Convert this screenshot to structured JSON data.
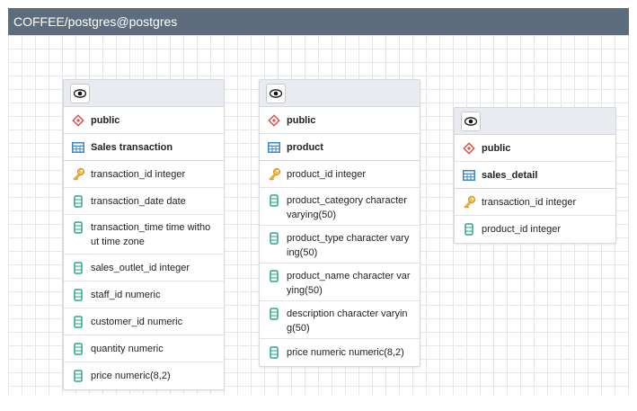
{
  "window": {
    "title": "COFFEE/postgres@postgres"
  },
  "colors": {
    "titlebar": "#5e6d7e",
    "schema_icon": "#d9534f",
    "table_icon": "#3a86c8",
    "key_icon": "#e0a82e",
    "column_icon": "#2aa58a"
  },
  "tables": [
    {
      "schema": "public",
      "name": "Sales transaction",
      "columns": [
        {
          "text": "transaction_id integer",
          "kind": "key"
        },
        {
          "text": "transaction_date date",
          "kind": "column"
        },
        {
          "text": "transaction_time time witho\nut time zone",
          "kind": "column"
        },
        {
          "text": "sales_outlet_id integer",
          "kind": "column"
        },
        {
          "text": "staff_id numeric",
          "kind": "column"
        },
        {
          "text": "customer_id numeric",
          "kind": "column"
        },
        {
          "text": "quantity numeric",
          "kind": "column"
        },
        {
          "text": "price  numeric(8,2)",
          "kind": "column"
        }
      ]
    },
    {
      "schema": "public",
      "name": "product",
      "columns": [
        {
          "text": "product_id integer",
          "kind": "key"
        },
        {
          "text": "product_category character\nvarying(50)",
          "kind": "column"
        },
        {
          "text": "product_type character vary\ning(50)",
          "kind": "column"
        },
        {
          "text": "product_name character var\nying(50)",
          "kind": "column"
        },
        {
          "text": "description character varyin\ng(50)",
          "kind": "column"
        },
        {
          "text": "price numeric numeric(8,2)",
          "kind": "column"
        }
      ]
    },
    {
      "schema": "public",
      "name": "sales_detail",
      "columns": [
        {
          "text": "transaction_id integer",
          "kind": "key"
        },
        {
          "text": "product_id integer",
          "kind": "column"
        }
      ]
    }
  ]
}
